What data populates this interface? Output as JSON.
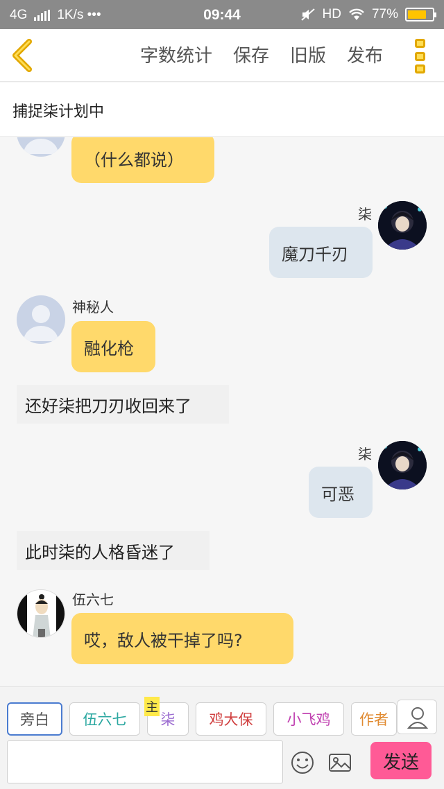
{
  "status_bar": {
    "network": "4G",
    "speed": "1K/s •••",
    "time": "09:44",
    "hd": "HD",
    "battery_text": "77%",
    "battery_level": 0.77
  },
  "header": {
    "actions": [
      "字数统计",
      "保存",
      "旧版",
      "发布"
    ],
    "accent_color": "#e2a800"
  },
  "story": {
    "title": "捕捉柒计划中"
  },
  "messages": [
    {
      "type": "left",
      "speaker": "",
      "avatar": "default-avatar",
      "text": "（什么都说）"
    },
    {
      "type": "right",
      "speaker": "柒",
      "avatar": "seven-avatar",
      "text": "魔刀千刃"
    },
    {
      "type": "left",
      "speaker": "神秘人",
      "avatar": "default-avatar",
      "text": "融化枪"
    },
    {
      "type": "narration",
      "text": "还好柒把刀刃收回来了"
    },
    {
      "type": "right",
      "speaker": "柒",
      "avatar": "seven-avatar",
      "text": "可恶"
    },
    {
      "type": "narration",
      "text": "此时柒的人格昏迷了"
    },
    {
      "type": "left",
      "speaker": "伍六七",
      "avatar": "wuliuqi-avatar",
      "text": "哎，敌人被干掉了吗?"
    }
  ],
  "roles": {
    "main_tag": "主",
    "chips": [
      {
        "label": "旁白",
        "color": "#555555",
        "selected": true
      },
      {
        "label": "伍六七",
        "color": "#2aa7a0",
        "selected": false
      },
      {
        "label": "柒",
        "color": "#9b6bd0",
        "selected": false
      },
      {
        "label": "鸡大保",
        "color": "#d04040",
        "selected": false
      },
      {
        "label": "小飞鸡",
        "color": "#c040b0",
        "selected": false
      },
      {
        "label": "作者",
        "color": "#e08a30",
        "selected": false
      }
    ]
  },
  "input": {
    "placeholder": "",
    "send_label": "发送",
    "send_color": "#ff5a96"
  },
  "colors": {
    "bubble_yellow": "#ffd96b",
    "bubble_blue": "#dde6ee"
  }
}
